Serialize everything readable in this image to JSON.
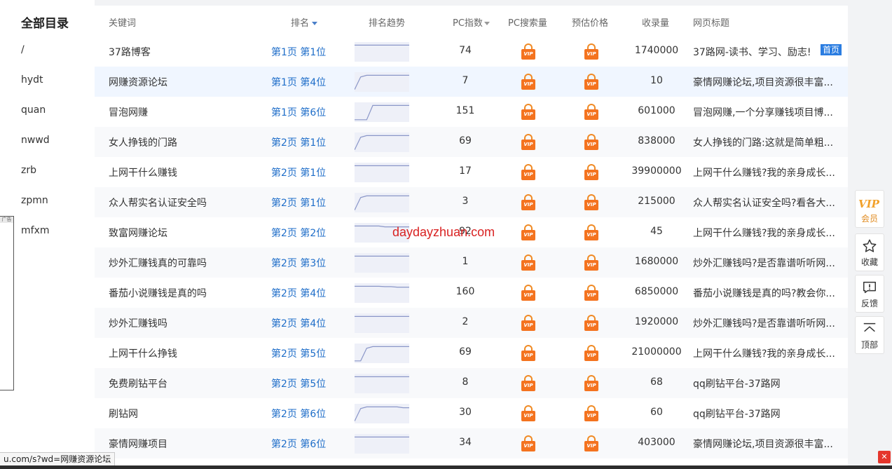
{
  "sidebar": {
    "title": "全部目录",
    "items": [
      "/",
      "hydt",
      "quan",
      "nwwd",
      "zrb",
      "zpmn",
      "mfxm"
    ],
    "ad_label": "广告"
  },
  "table": {
    "headers": {
      "keyword": "关键词",
      "rank": "排名",
      "trend": "排名趋势",
      "pc_index": "PC指数",
      "pc_search": "PC搜索量",
      "price": "预估价格",
      "indexed": "收录量",
      "title": "网页标题"
    },
    "vip_text": "VIP",
    "rows": [
      {
        "keyword": "37路博客",
        "rank": "第1页 第1位",
        "pc_index": "74",
        "indexed": "1740000",
        "title": "37路网-读书、学习、励志!",
        "badge": "首页",
        "trend": [
          0.1,
          0.1,
          0.1,
          0.1,
          0.1,
          0.1,
          0.1,
          0.1,
          0.1,
          0.1
        ]
      },
      {
        "keyword": "网赚资源论坛",
        "rank": "第1页 第4位",
        "pc_index": "7",
        "indexed": "10",
        "title": "豪情网赚论坛,项目资源很丰富...",
        "trend": [
          0.95,
          0.2,
          0.1,
          0.1,
          0.1,
          0.1,
          0.1,
          0.1,
          0.1,
          0.1
        ]
      },
      {
        "keyword": "冒泡网赚",
        "rank": "第1页 第6位",
        "pc_index": "151",
        "indexed": "601000",
        "title": "冒泡网赚,一个分享赚钱项目博...",
        "trend": [
          0.95,
          0.95,
          0.95,
          0.1,
          0.1,
          0.1,
          0.1,
          0.1,
          0.1,
          0.1
        ]
      },
      {
        "keyword": "女人挣钱的门路",
        "rank": "第2页 第1位",
        "pc_index": "69",
        "indexed": "838000",
        "title": "女人挣钱的门路:这就是简单粗...",
        "trend": [
          0.95,
          0.2,
          0.1,
          0.1,
          0.1,
          0.1,
          0.1,
          0.1,
          0.1,
          0.1
        ]
      },
      {
        "keyword": "上网干什么赚钱",
        "rank": "第2页 第1位",
        "pc_index": "17",
        "indexed": "39900000",
        "title": "上网干什么赚钱?我的亲身成长...",
        "trend": [
          0.1,
          0.1,
          0.1,
          0.1,
          0.1,
          0.1,
          0.1,
          0.1,
          0.1,
          0.1
        ]
      },
      {
        "keyword": "众人帮实名认证安全吗",
        "rank": "第2页 第1位",
        "pc_index": "3",
        "indexed": "215000",
        "title": "众人帮实名认证安全吗?看各大...",
        "trend": [
          0.95,
          0.2,
          0.1,
          0.1,
          0.1,
          0.1,
          0.1,
          0.1,
          0.1,
          0.1
        ]
      },
      {
        "keyword": "致富网赚论坛",
        "rank": "第2页 第2位",
        "pc_index": "92",
        "indexed": "45",
        "title": "上网干什么赚钱?我的亲身成长...",
        "trend": [
          0.1,
          0.1,
          0.1,
          0.1,
          0.1,
          0.15,
          0.15,
          0.15,
          0.15,
          0.15
        ]
      },
      {
        "keyword": "炒外汇赚钱真的可靠吗",
        "rank": "第2页 第3位",
        "pc_index": "1",
        "indexed": "1680000",
        "title": "炒外汇赚钱吗?是否靠谱听听网...",
        "trend": [
          0.1,
          0.1,
          0.1,
          0.1,
          0.1,
          0.1,
          0.1,
          0.1,
          0.1,
          0.1
        ]
      },
      {
        "keyword": "番茄小说赚钱是真的吗",
        "rank": "第2页 第4位",
        "pc_index": "160",
        "indexed": "6850000",
        "title": "番茄小说赚钱是真的吗?教会你...",
        "trend": [
          0.1,
          0.1,
          0.1,
          0.1,
          0.1,
          0.12,
          0.12,
          0.15,
          0.15,
          0.15
        ]
      },
      {
        "keyword": "炒外汇赚钱吗",
        "rank": "第2页 第4位",
        "pc_index": "2",
        "indexed": "1920000",
        "title": "炒外汇赚钱吗?是否靠谱听听网...",
        "trend": [
          0.1,
          0.1,
          0.1,
          0.1,
          0.1,
          0.1,
          0.1,
          0.1,
          0.1,
          0.1
        ]
      },
      {
        "keyword": "上网干什么挣钱",
        "rank": "第2页 第5位",
        "pc_index": "69",
        "indexed": "21000000",
        "title": "上网干什么赚钱?我的亲身成长...",
        "trend": [
          0.95,
          0.95,
          0.2,
          0.1,
          0.1,
          0.1,
          0.1,
          0.1,
          0.1,
          0.1
        ]
      },
      {
        "keyword": "免费刷钻平台",
        "rank": "第2页 第5位",
        "pc_index": "8",
        "indexed": "68",
        "title": "qq刷钻平台-37路网",
        "trend": [
          0.1,
          0.1,
          0.1,
          0.1,
          0.1,
          0.1,
          0.1,
          0.1,
          0.1,
          0.1
        ]
      },
      {
        "keyword": "刷钻网",
        "rank": "第2页 第6位",
        "pc_index": "30",
        "indexed": "60",
        "title": "qq刷钻平台-37路网",
        "trend": [
          0.95,
          0.2,
          0.1,
          0.1,
          0.1,
          0.1,
          0.1,
          0.1,
          0.15,
          0.15
        ]
      },
      {
        "keyword": "豪情网赚项目",
        "rank": "第2页 第6位",
        "pc_index": "34",
        "indexed": "403000",
        "title": "豪情网赚论坛,项目资源很丰富...",
        "trend": [
          0.1,
          0.1,
          0.1,
          0.1,
          0.1,
          0.1,
          0.1,
          0.1,
          0.1,
          0.1
        ]
      }
    ]
  },
  "watermark": "daydayzhuan.com",
  "floatbar": {
    "vip_mark": "VIP",
    "vip_label": "会员",
    "favorite_label": "收藏",
    "feedback_label": "反馈",
    "top_label": "顶部"
  },
  "statusbar": {
    "url": "u.com/s?wd=网赚资源论坛"
  },
  "colors": {
    "rank_link": "#1f6ec9",
    "vip_orange": "#f4731f",
    "badge_blue": "#2b7de1",
    "watermark_red": "#d92222"
  }
}
